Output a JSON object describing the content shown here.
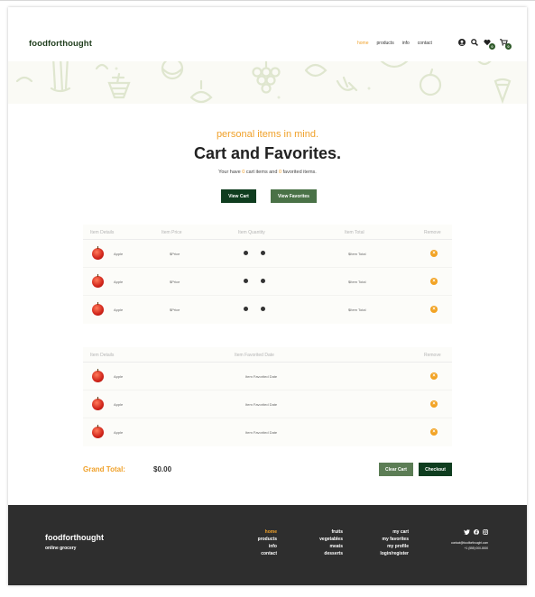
{
  "brand": "foodforthought",
  "nav": {
    "links": [
      {
        "label": "home",
        "active": true
      },
      {
        "label": "products",
        "active": false
      },
      {
        "label": "info",
        "active": false
      },
      {
        "label": "contact",
        "active": false
      }
    ],
    "icons": [
      "user-icon",
      "search-icon",
      "heart-icon",
      "cart-icon"
    ],
    "favorites_badge": "0",
    "cart_badge": "0"
  },
  "hero": {
    "subtitle": "personal items in mind.",
    "title": "Cart and Favorites.",
    "summary_prefix": "Your have ",
    "cart_count": "0",
    "summary_mid": " cart items and ",
    "fav_count": "0",
    "summary_suffix": " favorited items.",
    "view_cart": "View Cart",
    "view_favorites": "View Favorites"
  },
  "cart_table": {
    "headers": [
      "Item Details",
      "Item Price",
      "Item Quantity",
      "Item Total",
      "Remove"
    ],
    "rows": [
      {
        "name": "Apple",
        "price": "$Price",
        "total": "$Item Total"
      },
      {
        "name": "Apple",
        "price": "$Price",
        "total": "$Item Total"
      },
      {
        "name": "Apple",
        "price": "$Price",
        "total": "$Item Total"
      }
    ]
  },
  "fav_table": {
    "headers": [
      "Item Details",
      "Item Favorited Date",
      "Remove"
    ],
    "rows": [
      {
        "name": "Apple",
        "date": "Item Favorited Date"
      },
      {
        "name": "Apple",
        "date": "Item Favorited Date"
      },
      {
        "name": "Apple",
        "date": "Item Favorited Date"
      }
    ]
  },
  "totals": {
    "label": "Grand Total:",
    "value": "$0.00",
    "clear": "Clear Cart",
    "checkout": "Checkout"
  },
  "footer": {
    "brand": "foodforthought",
    "tagline": "online grocery",
    "col1": [
      "home",
      "products",
      "info",
      "contact"
    ],
    "col2": [
      "fruits",
      "vegetables",
      "meats",
      "desserts"
    ],
    "col3": [
      "my cart",
      "my favorites",
      "my profile",
      "login/register"
    ],
    "social": [
      "twitter-icon",
      "facebook-icon",
      "instagram-icon"
    ],
    "email": "contact@foodforthought.com",
    "phone": "+1 (555) 000-0000"
  },
  "colors": {
    "accent": "#f0a12a",
    "brand_dark": "#0f3d1f",
    "brand_mid": "#4a7247",
    "footer_bg": "#2e2e2e",
    "remove": "#f2a324"
  }
}
